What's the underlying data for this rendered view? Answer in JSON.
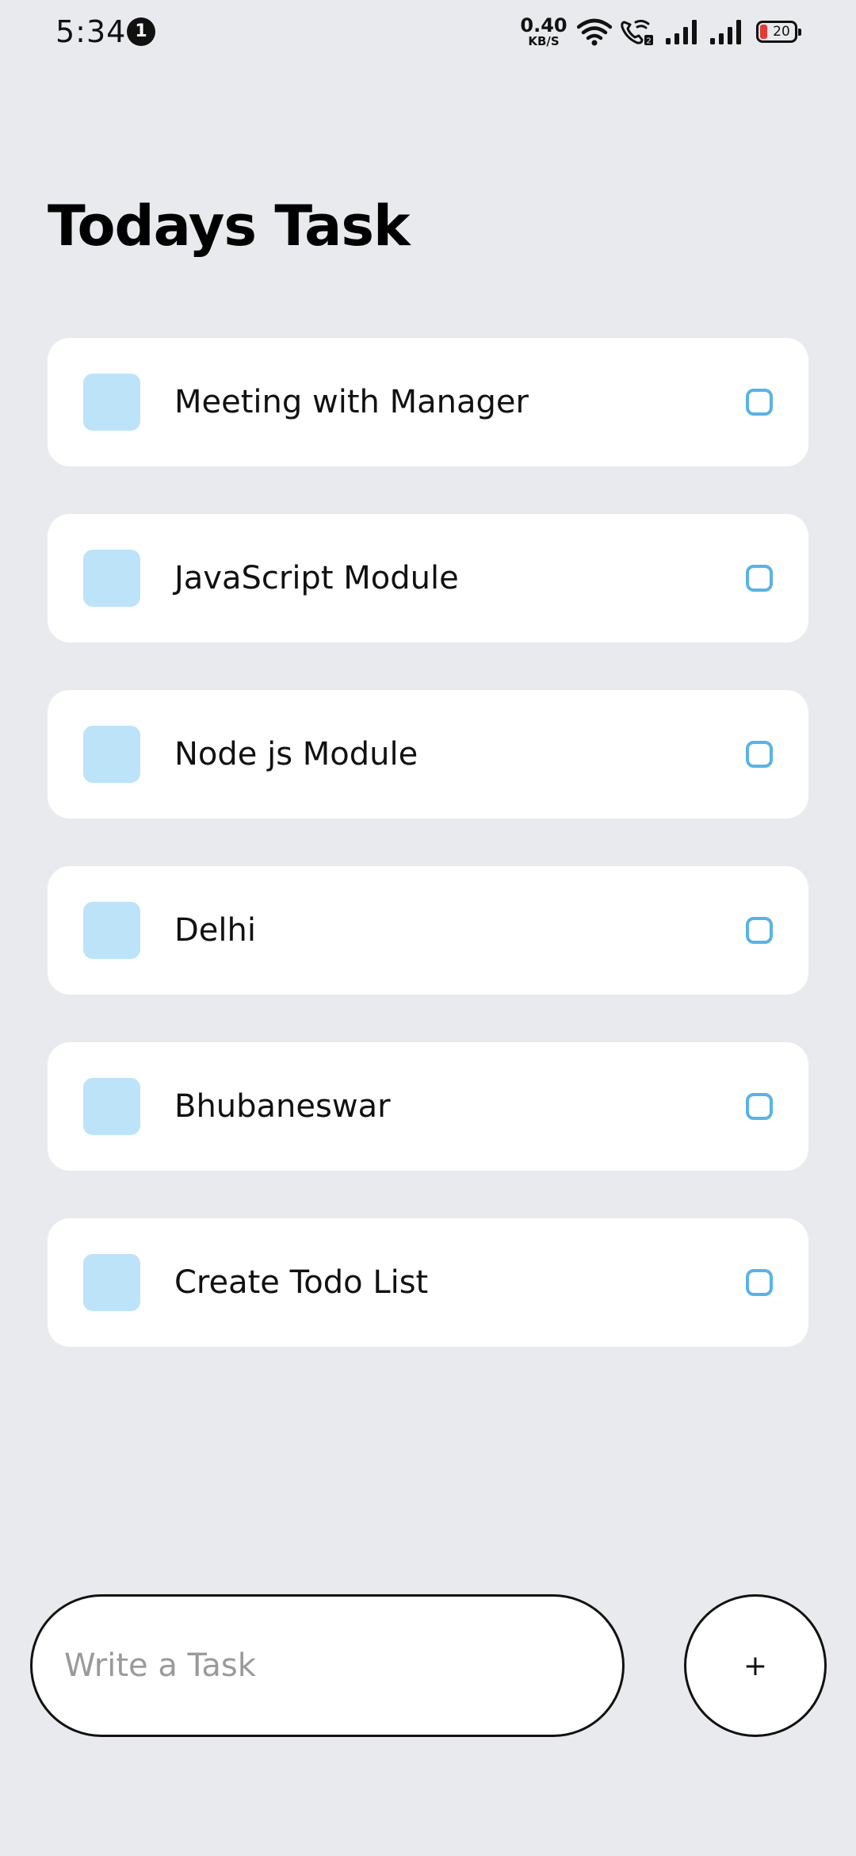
{
  "status_bar": {
    "time": "5:34",
    "notification_count": "1",
    "net_speed_value": "0.40",
    "net_speed_unit": "KB/S",
    "battery_level": "20",
    "icons": [
      "wifi-icon",
      "wifi-calling-icon",
      "signal-icon",
      "signal-icon",
      "battery-icon"
    ],
    "battery_low_color": "#E53935"
  },
  "header": {
    "title": "Todays Task"
  },
  "tasks": [
    {
      "text": "Meeting with Manager",
      "done": false
    },
    {
      "text": "JavaScript Module",
      "done": false
    },
    {
      "text": "Node js Module",
      "done": false
    },
    {
      "text": "Delhi",
      "done": false
    },
    {
      "text": "Bhubaneswar",
      "done": false
    },
    {
      "text": "Create Todo List",
      "done": false
    }
  ],
  "composer": {
    "placeholder": "Write a Task",
    "value": "",
    "add_label": "+"
  },
  "colors": {
    "background": "#E8EAED",
    "card": "#FFFFFF",
    "task_square": "#BDE3F8",
    "checkbox": "#5AB3E4"
  }
}
